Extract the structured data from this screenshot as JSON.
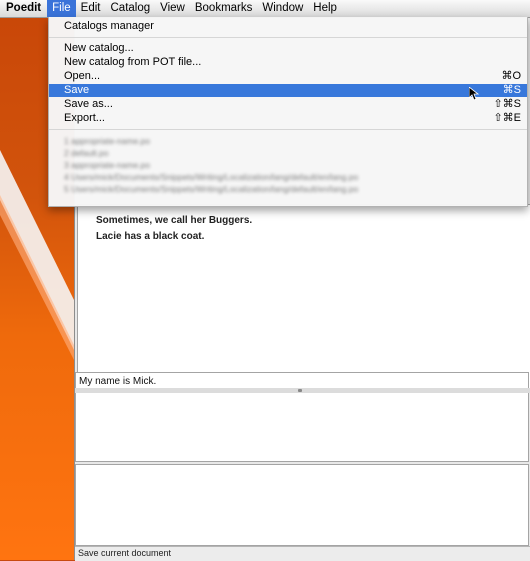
{
  "menubar": {
    "items": [
      "Poedit",
      "File",
      "Edit",
      "Catalog",
      "View",
      "Bookmarks",
      "Window",
      "Help"
    ]
  },
  "file_menu": {
    "items": [
      {
        "label": "Catalogs manager",
        "shortcut": ""
      },
      {
        "label": "New catalog...",
        "shortcut": ""
      },
      {
        "label": "New catalog from POT file...",
        "shortcut": ""
      },
      {
        "label": "Open...",
        "shortcut": "⌘O"
      },
      {
        "label": "Save",
        "shortcut": "⌘S"
      },
      {
        "label": "Save as...",
        "shortcut": "⇧⌘S"
      },
      {
        "label": "Export...",
        "shortcut": "⇧⌘E"
      }
    ],
    "recent": [
      "1 appropriate-name.po",
      "2 default.po",
      "3 appropriate-name.po",
      "4 Users/mick/Documents/Snippets/Writing/Localization/lang/default/en/lang.po",
      "5 Users/mick/Documents/Snippets/Writing/Localization/lang/default/en/lang.po"
    ]
  },
  "document": {
    "source_lines": [
      "Sometimes, we call her Buggers.",
      "Lacie has a black coat."
    ],
    "translation_text": "My name is Mick.",
    "status_text": "Save current document"
  }
}
